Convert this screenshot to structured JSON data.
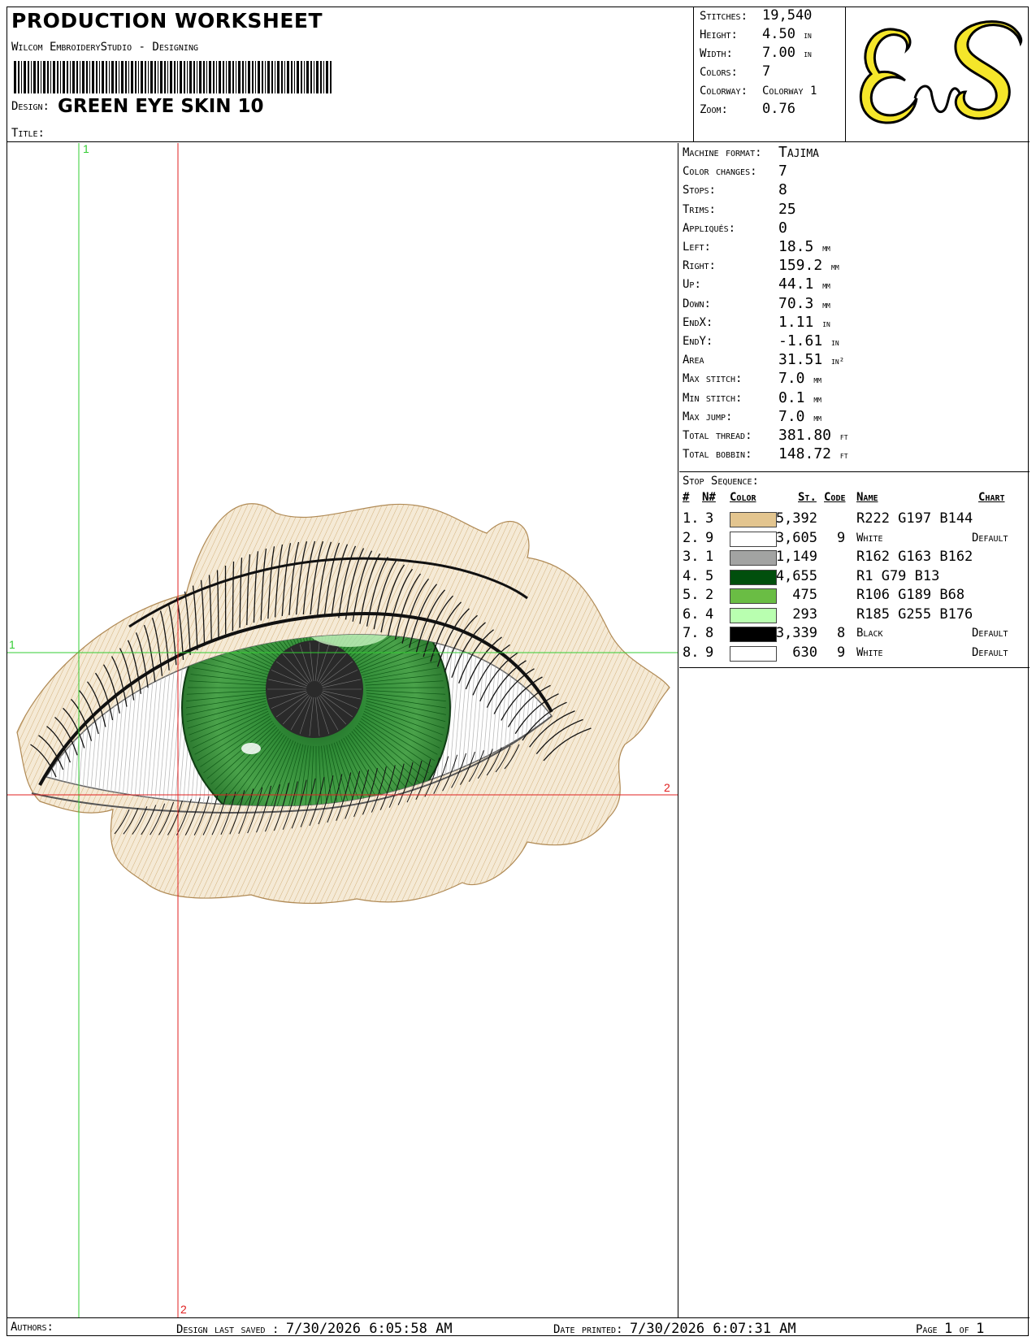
{
  "header": {
    "title": "PRODUCTION WORKSHEET",
    "subtitle": "Wilcom EmbroideryStudio - Designing",
    "design_label": "Design:",
    "design_name": "GREEN EYE SKIN  10",
    "title_label": "Title:",
    "title_value": ""
  },
  "stats": {
    "stitches_label": "Stitches:",
    "stitches": "19,540",
    "height_label": "Height:",
    "height": "4.50",
    "height_unit": "in",
    "width_label": "Width:",
    "width": "7.00",
    "width_unit": "in",
    "colors_label": "Colors:",
    "colors": "7",
    "colorway_label": "Colorway:",
    "colorway": "Colorway 1",
    "zoom_label": "Zoom:",
    "zoom": "0.76"
  },
  "logo": {
    "text": "EnS",
    "color": "#f5e62a"
  },
  "info": [
    {
      "label": "Machine format:",
      "value": "Tajima",
      "unit": ""
    },
    {
      "label": "Color changes:",
      "value": "7",
      "unit": ""
    },
    {
      "label": "Stops:",
      "value": "8",
      "unit": ""
    },
    {
      "label": "Trims:",
      "value": "25",
      "unit": ""
    },
    {
      "label": "Appliqués:",
      "value": "0",
      "unit": ""
    },
    {
      "label": "Left:",
      "value": "18.5",
      "unit": "mm"
    },
    {
      "label": "Right:",
      "value": "159.2",
      "unit": "mm"
    },
    {
      "label": "Up:",
      "value": "44.1",
      "unit": "mm"
    },
    {
      "label": "Down:",
      "value": "70.3",
      "unit": "mm"
    },
    {
      "label": "EndX:",
      "value": "1.11",
      "unit": "in"
    },
    {
      "label": "EndY:",
      "value": "-1.61",
      "unit": "in"
    },
    {
      "label": "Area",
      "value": "31.51",
      "unit": "in²"
    },
    {
      "label": "Max stitch:",
      "value": "7.0",
      "unit": "mm"
    },
    {
      "label": "Min stitch:",
      "value": "0.1",
      "unit": "mm"
    },
    {
      "label": "Max jump:",
      "value": "7.0",
      "unit": "mm"
    },
    {
      "label": "Total thread:",
      "value": "381.80",
      "unit": "ft"
    },
    {
      "label": "Total bobbin:",
      "value": "148.72",
      "unit": "ft"
    }
  ],
  "stop_sequence": {
    "title": "Stop Sequence:",
    "headers": {
      "num": "#",
      "n": "N#",
      "color": "Color",
      "st": "St.",
      "code": "Code",
      "name": "Name",
      "chart": "Chart"
    },
    "rows": [
      {
        "num": "1.",
        "n": "3",
        "color": "#e3c58f",
        "st": "5,392",
        "code": "",
        "name": "R222 G197 B144",
        "chart": ""
      },
      {
        "num": "2.",
        "n": "9",
        "color": "#ffffff",
        "st": "3,605",
        "code": "9",
        "name": "White",
        "chart": "Default"
      },
      {
        "num": "3.",
        "n": "1",
        "color": "#a2a3a2",
        "st": "1,149",
        "code": "",
        "name": "R162 G163 B162",
        "chart": ""
      },
      {
        "num": "4.",
        "n": "5",
        "color": "#014f0d",
        "st": "4,655",
        "code": "",
        "name": "R1 G79 B13",
        "chart": ""
      },
      {
        "num": "5.",
        "n": "2",
        "color": "#6abd44",
        "st": "475",
        "code": "",
        "name": "R106 G189 B68",
        "chart": ""
      },
      {
        "num": "6.",
        "n": "4",
        "color": "#b9ffb0",
        "st": "293",
        "code": "",
        "name": "R185 G255 B176",
        "chart": ""
      },
      {
        "num": "7.",
        "n": "8",
        "color": "#000000",
        "st": "3,339",
        "code": "8",
        "name": "Black",
        "chart": "Default"
      },
      {
        "num": "8.",
        "n": "9",
        "color": "#ffffff",
        "st": "630",
        "code": "9",
        "name": "White",
        "chart": "Default"
      }
    ]
  },
  "guides": {
    "marker_1": "1",
    "marker_2": "2",
    "green": "#33cc33",
    "red": "#e02020"
  },
  "footer": {
    "authors_label": "Authors:",
    "saved_label": "Design last saved :",
    "saved_value": "7/30/2026 6:05:58 AM",
    "printed_label": "Date printed:",
    "printed_value": "7/30/2026 6:07:31 AM",
    "page_label": "Page",
    "page_num": "1",
    "page_of": "of",
    "page_total": "1"
  }
}
